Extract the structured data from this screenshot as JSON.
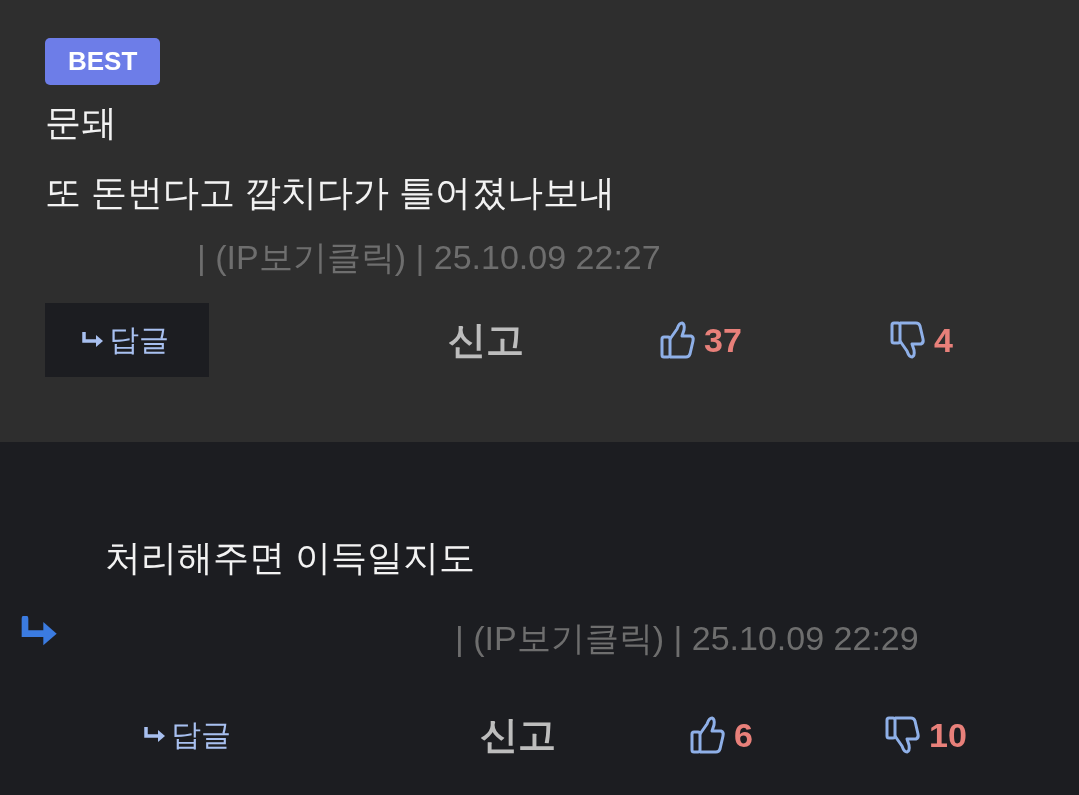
{
  "comments": [
    {
      "kind": "best",
      "badge": "BEST",
      "lines": [
        "문돼",
        "또 돈번다고 깝치다가 틀어졌나보내"
      ],
      "meta": "| (IP보기클릭) | 25.10.09 22:27",
      "reply_label": "답글",
      "report_label": "신고",
      "likes": "37",
      "dislikes": "4"
    },
    {
      "kind": "reply",
      "lines": [
        "처리해주면 이득일지도"
      ],
      "meta": "| (IP보기클릭) | 25.10.09 22:29",
      "reply_label": "답글",
      "report_label": "신고",
      "likes": "6",
      "dislikes": "10"
    }
  ]
}
